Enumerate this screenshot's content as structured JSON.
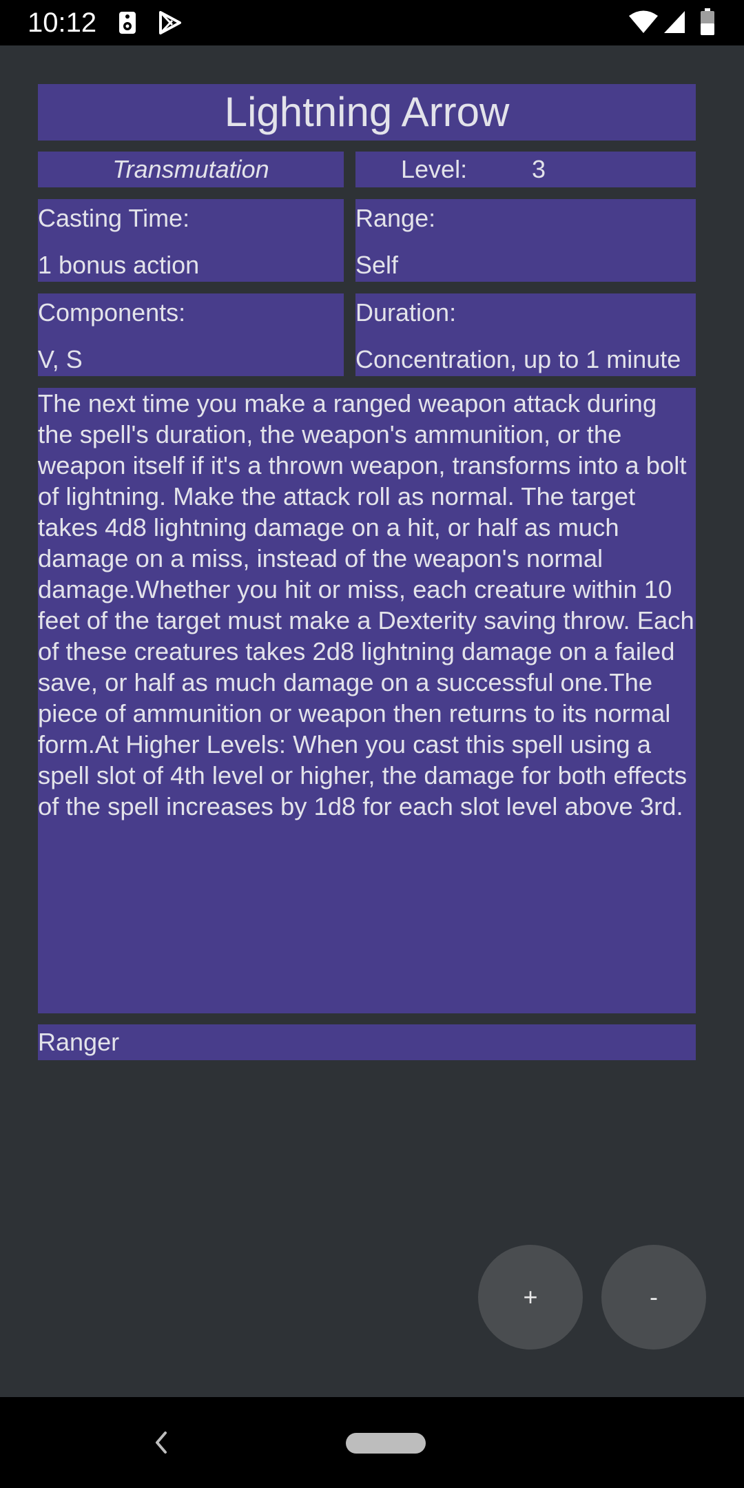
{
  "status_bar": {
    "time": "10:12",
    "icons": [
      "speaker-icon",
      "play-store-icon",
      "wifi-icon",
      "signal-icon",
      "battery-icon"
    ]
  },
  "spell": {
    "name": "Lightning Arrow",
    "school": "Transmutation",
    "level_label": "Level:",
    "level_value": "3",
    "casting_time_label": "Casting Time:",
    "casting_time_value": "1 bonus action",
    "range_label": "Range:",
    "range_value": "Self",
    "components_label": "Components:",
    "components_value": "V, S",
    "duration_label": "Duration:",
    "duration_value": "Concentration, up to 1 minute",
    "description": "The next time you make a ranged weapon attack during the spell's duration, the weapon's ammunition, or the weapon itself if it's a thrown weapon, transforms into a bolt of lightning. Make the attack roll as normal. The target takes 4d8 lightning damage on a hit, or half as much damage on a miss, instead of the weapon's normal damage.Whether you hit or miss, each creature within 10 feet of the target must make a Dexterity saving throw. Each of these creatures takes 2d8 lightning damage on a failed save, or half as much damage on a successful one.The piece of ammunition or weapon then returns to its normal form.At Higher Levels: When you cast this spell using a spell slot of 4th level or higher, the damage for both effects of the spell increases by 1d8 for each slot level above 3rd.",
    "classes": "Ranger"
  },
  "buttons": {
    "plus_label": "+",
    "minus_label": "-"
  },
  "colors": {
    "panel": "#483d8b",
    "background": "#2e3236",
    "fab": "#4a4d50"
  }
}
